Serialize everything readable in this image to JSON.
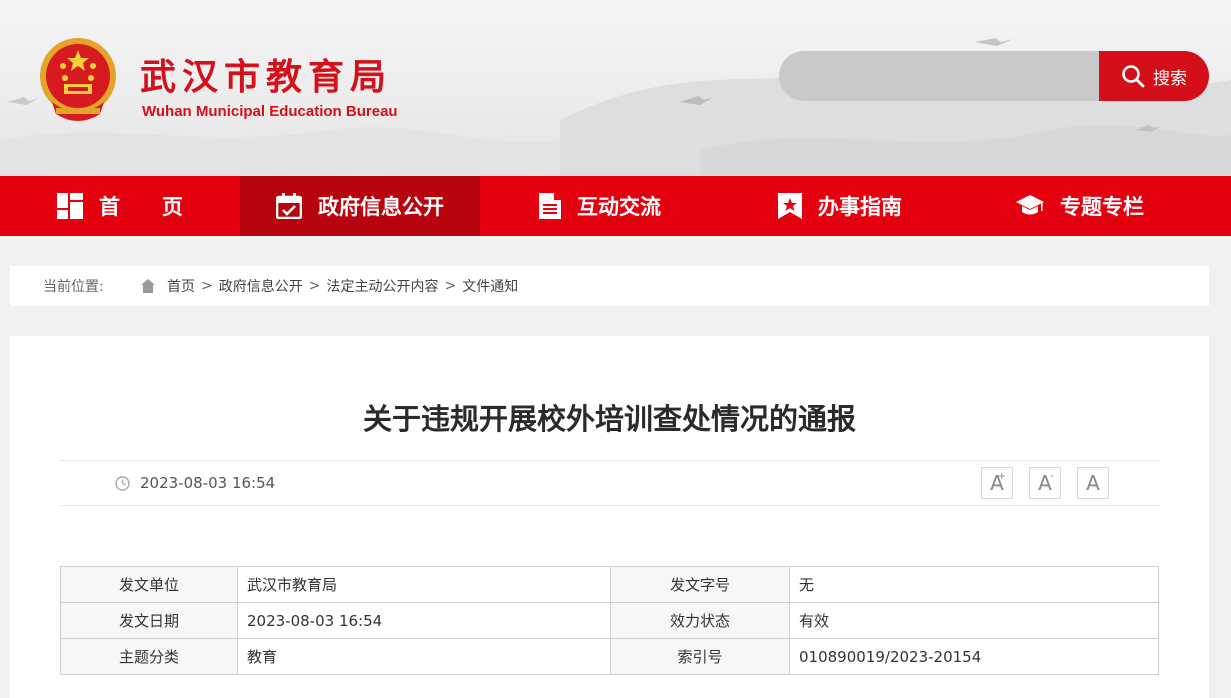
{
  "header": {
    "title": "武汉市教育局",
    "subtitle": "Wuhan Municipal Education Bureau",
    "search_placeholder": "",
    "search_label": "搜索"
  },
  "nav": {
    "items": [
      {
        "label": "首页",
        "icon": "grid-icon"
      },
      {
        "label": "政府信息公开",
        "icon": "calendar-check-icon"
      },
      {
        "label": "互动交流",
        "icon": "document-icon"
      },
      {
        "label": "办事指南",
        "icon": "bookmark-star-icon"
      },
      {
        "label": "专题专栏",
        "icon": "graduation-cap-icon"
      }
    ],
    "active_index": 1
  },
  "breadcrumb": {
    "label": "当前位置:",
    "items": [
      "首页",
      "政府信息公开",
      "法定主动公开内容",
      "文件通知"
    ],
    "separator": ">"
  },
  "article": {
    "title": "关于违规开展校外培训查处情况的通报",
    "date": "2023-08-03 16:54",
    "font_controls": [
      "A",
      "A",
      "A"
    ],
    "info": [
      {
        "k1": "发文单位",
        "v1": "武汉市教育局",
        "k2": "发文字号",
        "v2": "无"
      },
      {
        "k1": "发文日期",
        "v1": "2023-08-03 16:54",
        "k2": "效力状态",
        "v2": "有效"
      },
      {
        "k1": "主题分类",
        "v1": "教育",
        "k2": "索引号",
        "v2": "010890019/2023-20154"
      }
    ]
  },
  "colors": {
    "brand_red": "#e5000f",
    "nav_active": "#b8040f",
    "title_red": "#d4101a"
  }
}
